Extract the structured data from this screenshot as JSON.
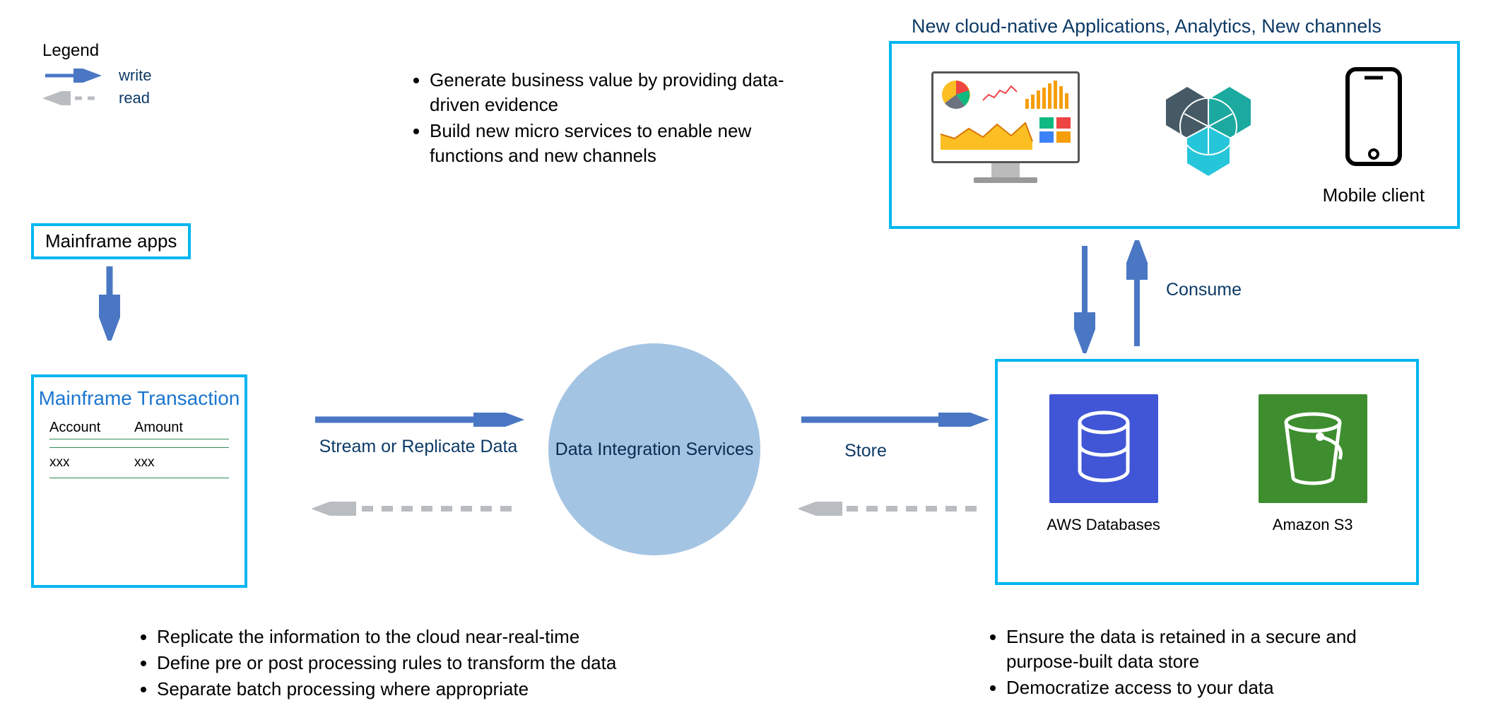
{
  "legend": {
    "title": "Legend",
    "write": "write",
    "read": "read"
  },
  "boxes": {
    "mainframe_apps": "Mainframe apps",
    "mainframe_txn_title": "Mainframe Transaction",
    "txn_col1": "Account",
    "txn_col2": "Amount",
    "txn_val1": "xxx",
    "txn_val2": "xxx",
    "circle": "Data Integration Services",
    "aws_db": "AWS Databases",
    "s3": "Amazon S3",
    "cloud_title": "New cloud-native Applications, Analytics, New channels",
    "mobile": "Mobile client"
  },
  "flows": {
    "stream": "Stream or Replicate Data",
    "store": "Store",
    "consume": "Consume"
  },
  "bullets_top": [
    "Generate business value by providing data-driven evidence",
    "Build new micro services to enable new functions and new channels"
  ],
  "bullets_bottom_left": [
    "Replicate the information to the cloud near-real-time",
    "Define pre or post processing rules to transform the data",
    "Separate batch processing where appropriate"
  ],
  "bullets_bottom_right": [
    "Ensure the data is retained in a secure and purpose-built data store",
    "Democratize access to your data"
  ]
}
